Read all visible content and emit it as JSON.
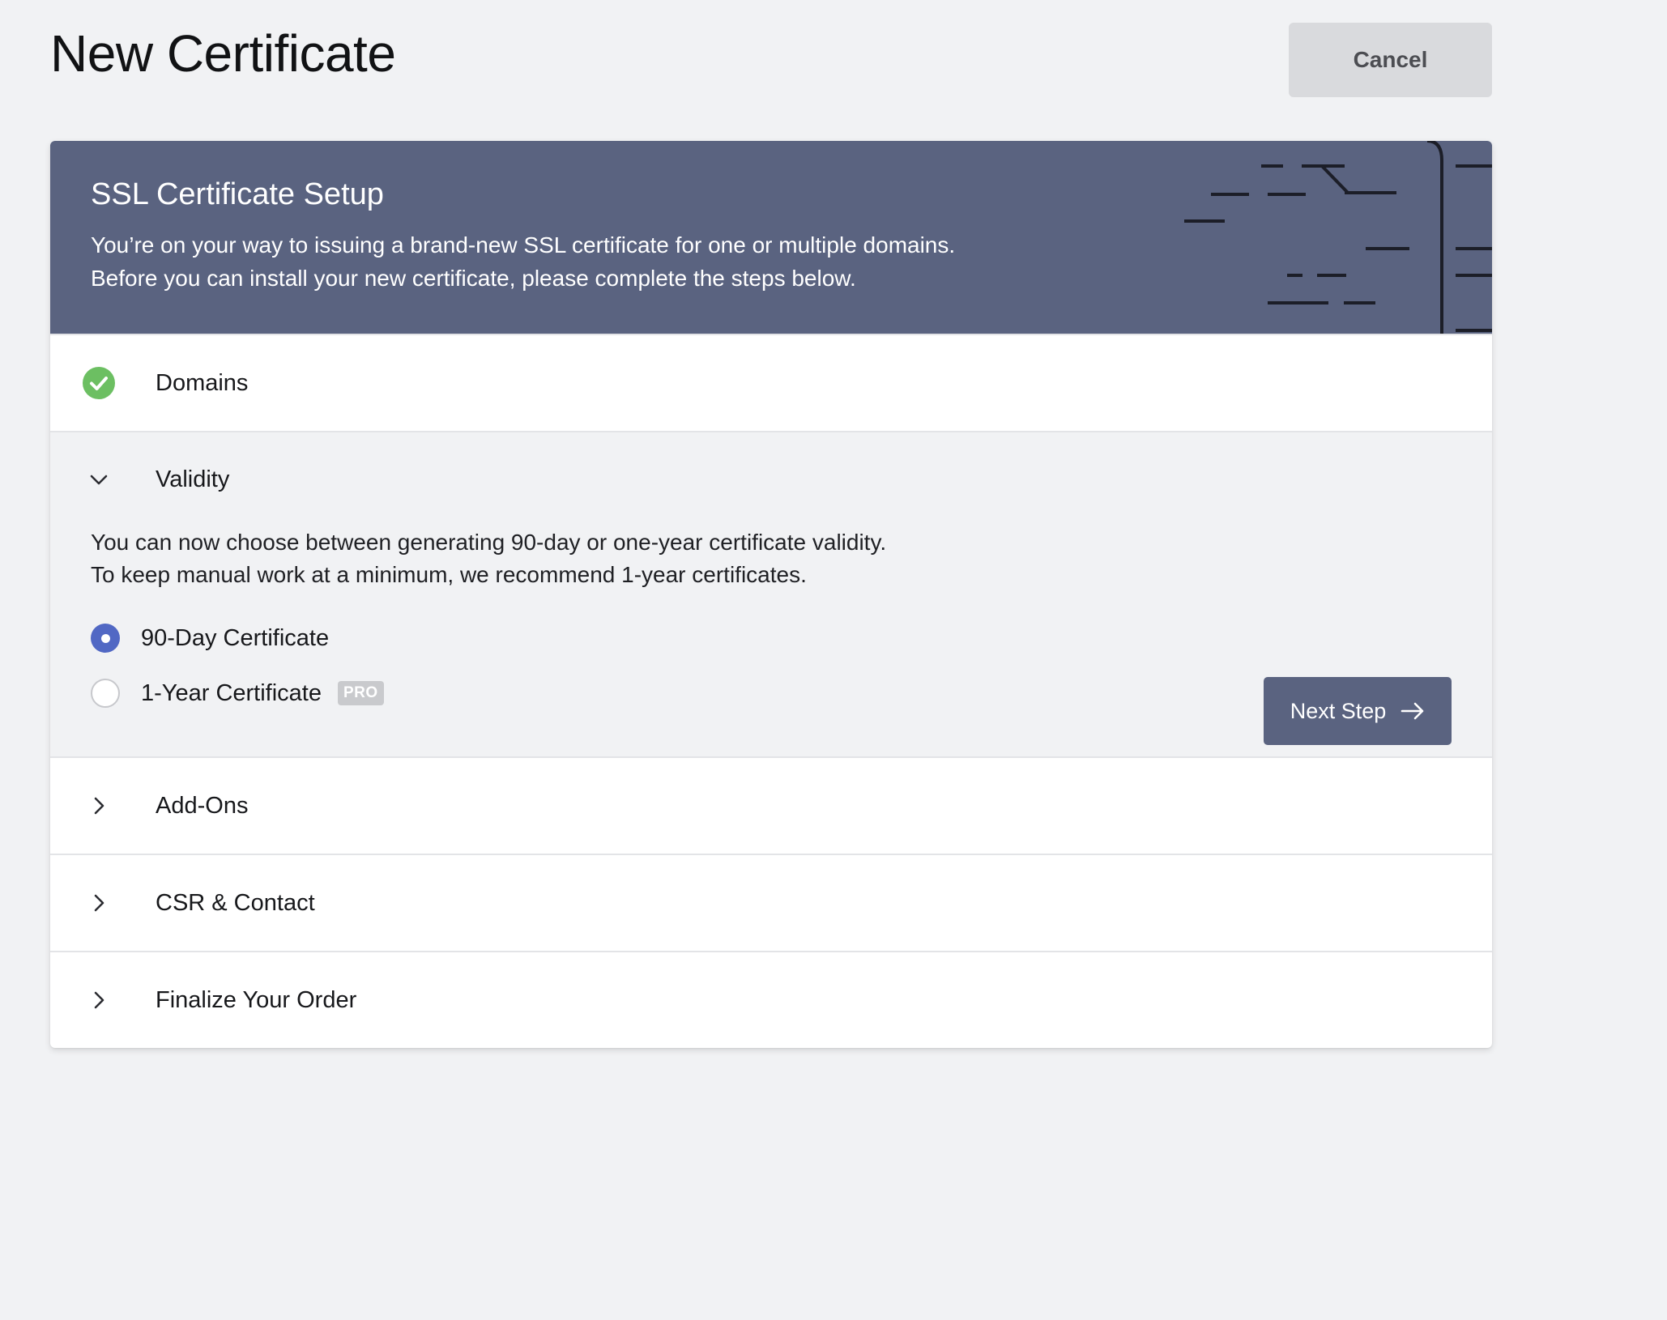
{
  "page": {
    "title": "New Certificate",
    "cancel_label": "Cancel"
  },
  "header": {
    "title": "SSL Certificate Setup",
    "description_line1": "You’re on your way to issuing a brand-new SSL certificate for one or multiple domains.",
    "description_line2": "Before you can install your new certificate, please complete the steps below."
  },
  "steps": [
    {
      "label": "Domains",
      "state": "completed",
      "icon": "check-circle-icon"
    },
    {
      "label": "Validity",
      "state": "expanded",
      "icon": "chevron-down-icon"
    },
    {
      "label": "Add-Ons",
      "state": "collapsed",
      "icon": "chevron-right-icon"
    },
    {
      "label": "CSR & Contact",
      "state": "collapsed",
      "icon": "chevron-right-icon"
    },
    {
      "label": "Finalize Your Order",
      "state": "collapsed",
      "icon": "chevron-right-icon"
    }
  ],
  "validity": {
    "text_line1": "You can now choose between generating 90-day or one-year certificate validity.",
    "text_line2": "To keep manual work at a minimum, we recommend 1-year certificates.",
    "options": [
      {
        "label": "90-Day Certificate",
        "selected": true
      },
      {
        "label": "1-Year Certificate",
        "selected": false,
        "badge": "PRO"
      }
    ],
    "next_label": "Next Step"
  },
  "colors": {
    "header_bg": "#5a6380",
    "check_green": "#6cbf62",
    "radio_selected": "#5168c4",
    "page_bg": "#f1f2f4"
  }
}
